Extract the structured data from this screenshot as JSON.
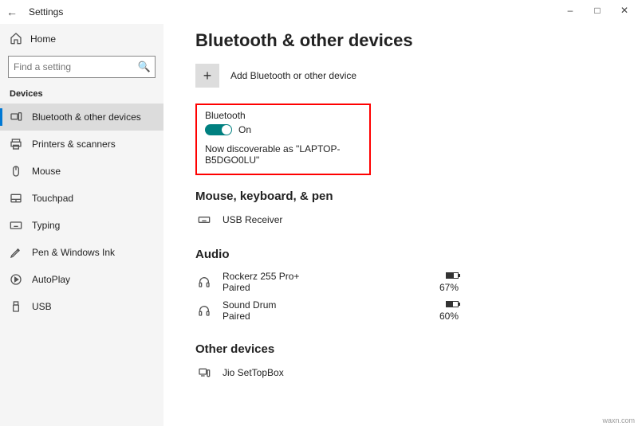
{
  "window": {
    "title": "Settings"
  },
  "sidebar": {
    "home": "Home",
    "search_placeholder": "Find a setting",
    "group": "Devices",
    "items": [
      {
        "label": "Bluetooth & other devices"
      },
      {
        "label": "Printers & scanners"
      },
      {
        "label": "Mouse"
      },
      {
        "label": "Touchpad"
      },
      {
        "label": "Typing"
      },
      {
        "label": "Pen & Windows Ink"
      },
      {
        "label": "AutoPlay"
      },
      {
        "label": "USB"
      }
    ]
  },
  "main": {
    "heading": "Bluetooth & other devices",
    "add_label": "Add Bluetooth or other device",
    "bluetooth": {
      "label": "Bluetooth",
      "state": "On",
      "discoverable": "Now discoverable as \"LAPTOP-B5DGO0LU\""
    },
    "sections": {
      "mouse_kb": "Mouse, keyboard, & pen",
      "audio": "Audio",
      "other": "Other devices"
    },
    "devices": {
      "usb_receiver": "USB Receiver",
      "rockerz": {
        "name": "Rockerz 255 Pro+",
        "status": "Paired",
        "pct": "67%"
      },
      "sound_drum": {
        "name": "Sound Drum",
        "status": "Paired",
        "pct": "60%"
      },
      "stb": "Jio SetTopBox"
    }
  },
  "watermark": "waxn.com"
}
